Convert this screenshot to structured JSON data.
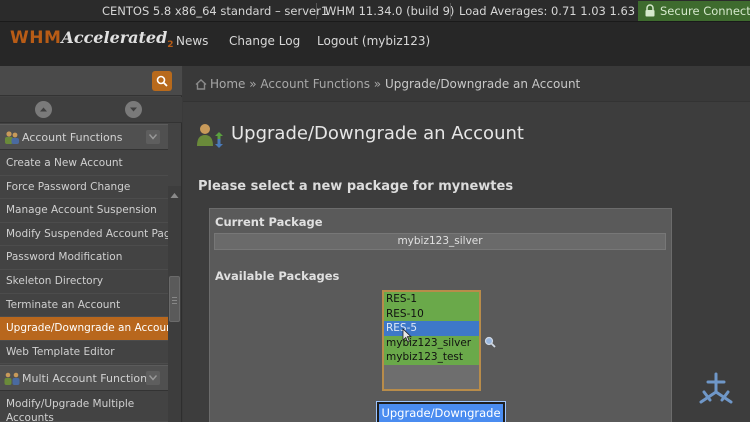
{
  "statusbar": {
    "server": "CENTOS 5.8 x86_64 standard – server1",
    "version": "WHM 11.34.0 (build 9)",
    "load": "Load Averages: 0.71 1.03 1.63",
    "secure": "Secure Connection"
  },
  "header": {
    "logo_main": "WHM",
    "logo_sub": "Accelerated",
    "logo_num": "2",
    "nav": [
      "News",
      "Change Log",
      "Logout (mybiz123)"
    ]
  },
  "sidebar": {
    "section1": "Account Functions",
    "items": [
      "Create a New Account",
      "Force Password Change",
      "Manage Account Suspension",
      "Modify Suspended Account Page",
      "Password Modification",
      "Skeleton Directory",
      "Terminate an Account",
      "Upgrade/Downgrade an Account",
      "Web Template Editor"
    ],
    "section2": "Multi Account Functions",
    "items2": [
      "Modify/Upgrade Multiple Accounts"
    ]
  },
  "breadcrumb": {
    "home": "Home",
    "sep": " » ",
    "parent": "Account Functions",
    "current": "Upgrade/Downgrade an Account"
  },
  "main": {
    "title": "Upgrade/Downgrade an Account",
    "subtitle": "Please select a new package for mynewtes",
    "current_label": "Current Package",
    "current_value": "mybiz123_silver",
    "available_label": "Available Packages",
    "packages": [
      "RES-1",
      "RES-10",
      "RES-5",
      "mybiz123_silver",
      "mybiz123_test"
    ],
    "selected_package": "RES-5",
    "submit": "Upgrade/Downgrade"
  },
  "colors": {
    "accent": "#b8671d",
    "secure_green": "#3e6b2e",
    "option_green": "#6aa94a",
    "selection_blue": "#3e78c8",
    "button_blue": "#4a8cf0"
  }
}
